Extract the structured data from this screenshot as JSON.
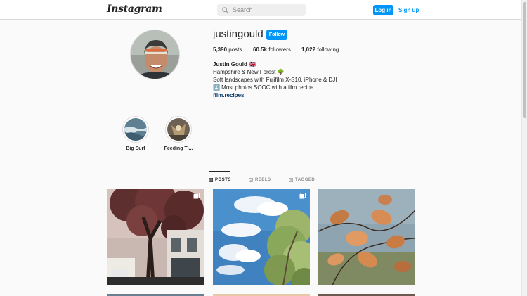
{
  "nav": {
    "logo": "Instagram",
    "search_placeholder": "Search",
    "login_label": "Log in",
    "signup_label": "Sign up"
  },
  "profile": {
    "username": "justingould",
    "follow_label": "Follow",
    "stats": {
      "posts_count": "5,390",
      "posts_label": " posts",
      "followers_count": "60.5k",
      "followers_label": " followers",
      "following_count": "1,022",
      "following_label": " following"
    },
    "bio": {
      "name": "Justin Gould 🇬🇧",
      "line1": "Hampshire & New Forest 🌳",
      "line2": "Soft landscapes with Fujifilm X-S10, iPhone & DJI",
      "line3": "⬇️ Most photos SOOC with a film recipe",
      "link": "film.recipes"
    }
  },
  "highlights": [
    {
      "label": "Big Surf"
    },
    {
      "label": "Feeding Ti..."
    }
  ],
  "tabs": [
    {
      "label": "POSTS",
      "icon": "grid-icon",
      "active": true
    },
    {
      "label": "REELS",
      "icon": "reels-icon",
      "active": false
    },
    {
      "label": "TAGGED",
      "icon": "tagged-icon",
      "active": false
    }
  ],
  "colors": {
    "accent": "#0095f6",
    "text": "#262626",
    "muted": "#8e8e8e",
    "background": "#fafafa"
  }
}
